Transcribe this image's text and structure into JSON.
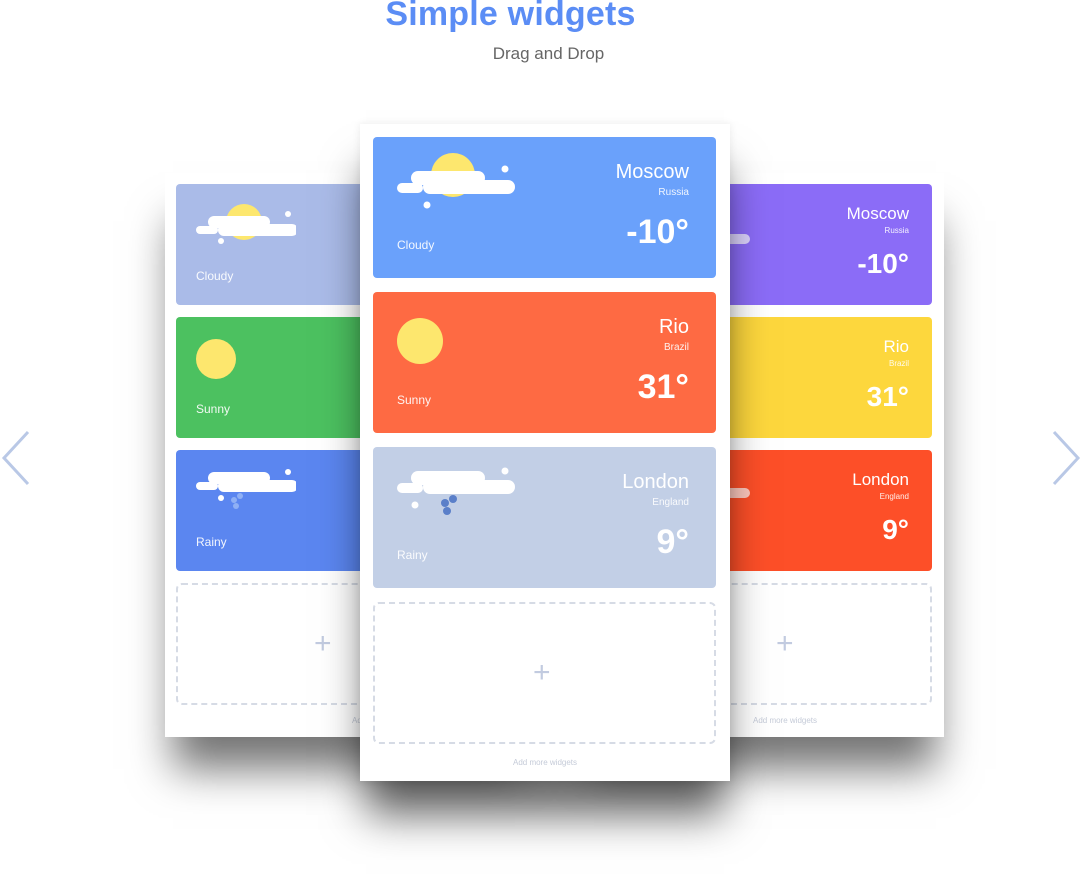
{
  "header": {
    "title": "Simple widgets",
    "subtitle": "Drag and Drop"
  },
  "navigation": {
    "prev_icon": "chevron-left-icon",
    "next_icon": "chevron-right-icon",
    "arrow_color": "#b9c8e6"
  },
  "left_panel": {
    "widgets": [
      {
        "condition": "Cloudy",
        "icon": "cloud-sun-icon",
        "color": "#aabbe8"
      },
      {
        "condition": "Sunny",
        "icon": "sun-icon",
        "color": "#4cc160"
      },
      {
        "condition": "Rainy",
        "icon": "rain-cloud-icon",
        "color": "#5b86f0"
      }
    ],
    "add_more": "Add more widgets"
  },
  "center_panel": {
    "widgets": [
      {
        "condition": "Cloudy",
        "city": "Moscow",
        "country": "Russia",
        "temp": "-10°",
        "icon": "cloud-sun-icon",
        "color": "#6aa1fb"
      },
      {
        "condition": "Sunny",
        "city": "Rio",
        "country": "Brazil",
        "temp": "31°",
        "icon": "sun-icon",
        "color": "#fe6a43"
      },
      {
        "condition": "Rainy",
        "city": "London",
        "country": "England",
        "temp": "9°",
        "icon": "rain-cloud-icon",
        "color": "#c2cfe6"
      }
    ],
    "add_more": "Add more widgets"
  },
  "right_panel": {
    "widgets": [
      {
        "city": "Moscow",
        "country": "Russia",
        "temp": "-10°",
        "color": "#8b6cf7"
      },
      {
        "city": "Rio",
        "country": "Brazil",
        "temp": "31°",
        "color": "#fdd73d"
      },
      {
        "city": "London",
        "country": "England",
        "temp": "9°",
        "color": "#fd4f28"
      }
    ],
    "add_more": "Add more widgets"
  }
}
